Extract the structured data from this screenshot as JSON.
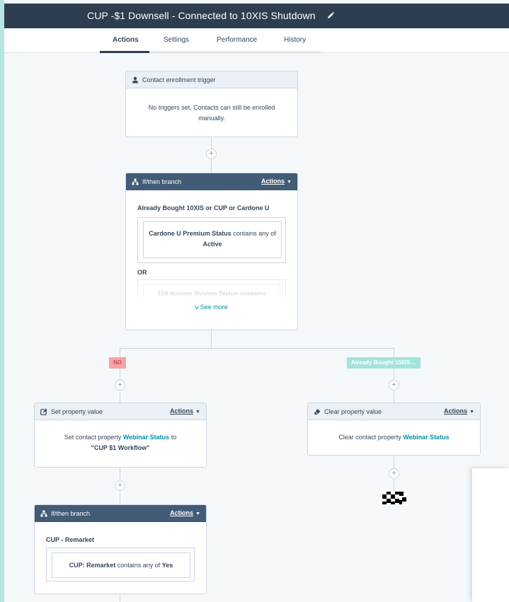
{
  "workflow": {
    "title": "CUP -$1 Downsell - Connected to 10XIS Shutdown"
  },
  "tabs": {
    "actions": "Actions",
    "settings": "Settings",
    "performance": "Performance",
    "history": "History"
  },
  "trigger": {
    "header": "Contact enrollment trigger",
    "body": "No triggers set. Contacts can still be enrolled manually."
  },
  "branch1": {
    "header": "If/then branch",
    "actions": "Actions",
    "condition_title": "Already Bought 10XIS or CUP or Cardone U",
    "filter_property": "Cardone U Premium Status",
    "filter_op": "contains any of",
    "filter_value": "Active",
    "or_label": "OR",
    "faded_filter": "10X Income System Status contains",
    "see_more": "See more"
  },
  "labels": {
    "no": "NO",
    "yes_branch": "Already Bought 10XIS ..."
  },
  "set_prop": {
    "header": "Set property value",
    "actions": "Actions",
    "text_pre": "Set contact property",
    "property": "Webinar Status",
    "text_to": "to",
    "value": "\"CUP $1 Workflow\""
  },
  "clear_prop": {
    "header": "Clear property value",
    "actions": "Actions",
    "text_pre": "Clear contact property",
    "property": "Webinar Status"
  },
  "branch2": {
    "header": "If/then branch",
    "actions": "Actions",
    "condition_title": "CUP - Remarket",
    "filter_property": "CUP: Remarket",
    "filter_op": "contains any of",
    "filter_value": "Yes"
  },
  "colors": {
    "header_bg": "#2d3e50",
    "branch_head": "#425b76",
    "no_label_bg": "#f2a5a5",
    "yes_label_bg": "#a4e3dc",
    "link": "#0091ae"
  },
  "plus_symbol": "+"
}
